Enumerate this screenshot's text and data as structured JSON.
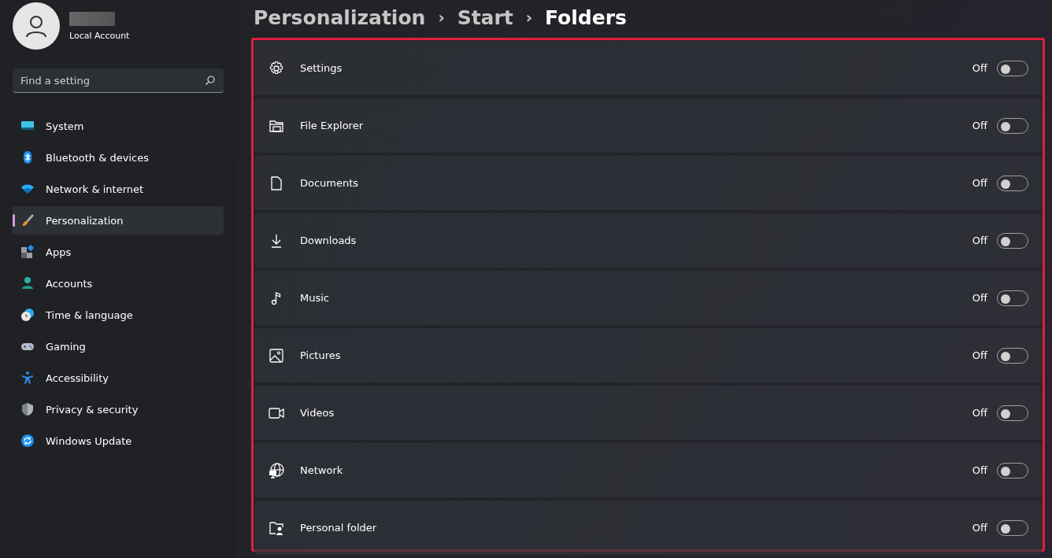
{
  "account": {
    "name_hidden": true,
    "subtitle": "Local Account"
  },
  "search": {
    "placeholder": "Find a setting"
  },
  "sidebar": {
    "items": [
      {
        "label": "System",
        "selected": false
      },
      {
        "label": "Bluetooth & devices",
        "selected": false
      },
      {
        "label": "Network & internet",
        "selected": false
      },
      {
        "label": "Personalization",
        "selected": true
      },
      {
        "label": "Apps",
        "selected": false
      },
      {
        "label": "Accounts",
        "selected": false
      },
      {
        "label": "Time & language",
        "selected": false
      },
      {
        "label": "Gaming",
        "selected": false
      },
      {
        "label": "Accessibility",
        "selected": false
      },
      {
        "label": "Privacy & security",
        "selected": false
      },
      {
        "label": "Windows Update",
        "selected": false
      }
    ]
  },
  "breadcrumb": [
    {
      "label": "Personalization",
      "current": false
    },
    {
      "label": "Start",
      "current": false
    },
    {
      "label": "Folders",
      "current": true
    }
  ],
  "separators": [
    "›",
    "›"
  ],
  "folders": [
    {
      "label": "Settings",
      "state": "Off",
      "on": false
    },
    {
      "label": "File Explorer",
      "state": "Off",
      "on": false
    },
    {
      "label": "Documents",
      "state": "Off",
      "on": false
    },
    {
      "label": "Downloads",
      "state": "Off",
      "on": false
    },
    {
      "label": "Music",
      "state": "Off",
      "on": false
    },
    {
      "label": "Pictures",
      "state": "Off",
      "on": false
    },
    {
      "label": "Videos",
      "state": "Off",
      "on": false
    },
    {
      "label": "Network",
      "state": "Off",
      "on": false
    },
    {
      "label": "Personal folder",
      "state": "Off",
      "on": false
    }
  ]
}
